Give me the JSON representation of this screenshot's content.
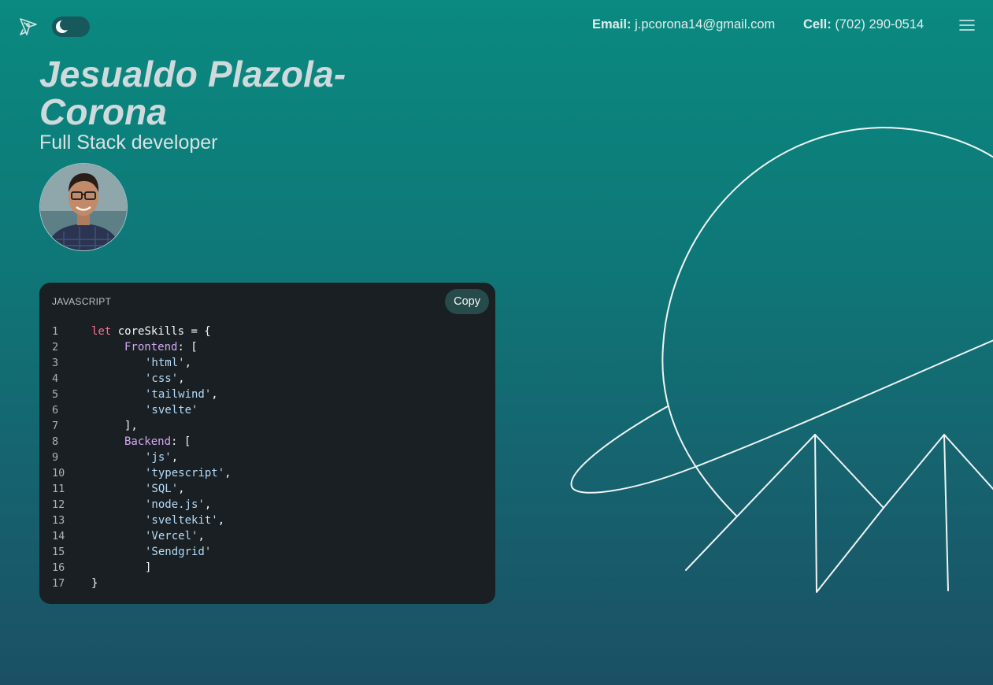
{
  "header": {
    "email_label": "Email:",
    "email_value": "j.pcorona14@gmail.com",
    "cell_label": "Cell:",
    "cell_value": "(702) 290-0514",
    "theme_toggle_state": "dark"
  },
  "hero": {
    "name": "Jesualdo Plazola-Corona",
    "role": "Full Stack developer"
  },
  "code_block": {
    "language": "JAVASCRIPT",
    "copy_label": "Copy",
    "lines": [
      {
        "n": "1",
        "parts": [
          {
            "t": "let",
            "c": "kw"
          },
          {
            "t": " coreSkills = {",
            "c": "plain"
          }
        ]
      },
      {
        "n": "2",
        "indent": 1,
        "parts": [
          {
            "t": "Frontend",
            "c": "prop"
          },
          {
            "t": ": [",
            "c": "plain"
          }
        ]
      },
      {
        "n": "3",
        "indent": 2,
        "parts": [
          {
            "t": "'html'",
            "c": "str"
          },
          {
            "t": ",",
            "c": "plain"
          }
        ]
      },
      {
        "n": "4",
        "indent": 2,
        "parts": [
          {
            "t": "'css'",
            "c": "str"
          },
          {
            "t": ",",
            "c": "plain"
          }
        ]
      },
      {
        "n": "5",
        "indent": 2,
        "parts": [
          {
            "t": "'tailwind'",
            "c": "str"
          },
          {
            "t": ",",
            "c": "plain"
          }
        ]
      },
      {
        "n": "6",
        "indent": 2,
        "parts": [
          {
            "t": "'svelte'",
            "c": "str"
          }
        ]
      },
      {
        "n": "7",
        "indent": 1,
        "parts": [
          {
            "t": "],",
            "c": "plain"
          }
        ]
      },
      {
        "n": "8",
        "indent": 1,
        "parts": [
          {
            "t": "Backend",
            "c": "prop"
          },
          {
            "t": ": [",
            "c": "plain"
          }
        ]
      },
      {
        "n": "9",
        "indent": 2,
        "parts": [
          {
            "t": "'js'",
            "c": "str"
          },
          {
            "t": ",",
            "c": "plain"
          }
        ]
      },
      {
        "n": "10",
        "indent": 2,
        "parts": [
          {
            "t": "'typescript'",
            "c": "str"
          },
          {
            "t": ",",
            "c": "plain"
          }
        ]
      },
      {
        "n": "11",
        "indent": 2,
        "parts": [
          {
            "t": "'SQL'",
            "c": "str"
          },
          {
            "t": ",",
            "c": "plain"
          }
        ]
      },
      {
        "n": "12",
        "indent": 2,
        "parts": [
          {
            "t": "'node.js'",
            "c": "str"
          },
          {
            "t": ",",
            "c": "plain"
          }
        ]
      },
      {
        "n": "13",
        "indent": 2,
        "parts": [
          {
            "t": "'sveltekit'",
            "c": "str"
          },
          {
            "t": ",",
            "c": "plain"
          }
        ]
      },
      {
        "n": "14",
        "indent": 2,
        "parts": [
          {
            "t": "'Vercel'",
            "c": "str"
          },
          {
            "t": ",",
            "c": "plain"
          }
        ]
      },
      {
        "n": "15",
        "indent": 2,
        "parts": [
          {
            "t": "'Sendgrid'",
            "c": "str"
          }
        ]
      },
      {
        "n": "16",
        "indent": 2,
        "parts": [
          {
            "t": "]",
            "c": "plain"
          }
        ]
      },
      {
        "n": "17",
        "parts": [
          {
            "t": "}",
            "c": "plain"
          }
        ]
      }
    ]
  },
  "colors": {
    "keyword": "#f7728c",
    "property": "#d4a8f5",
    "string": "#b5dcfb",
    "code_background": "#191f22",
    "background_top": "#0a8a80",
    "background_bottom": "#1b5064"
  },
  "icons": {
    "logo": "rocket-icon",
    "toggle": "moon-icon",
    "menu": "hamburger-menu-icon",
    "decoration": "planet-mountains-illustration"
  }
}
